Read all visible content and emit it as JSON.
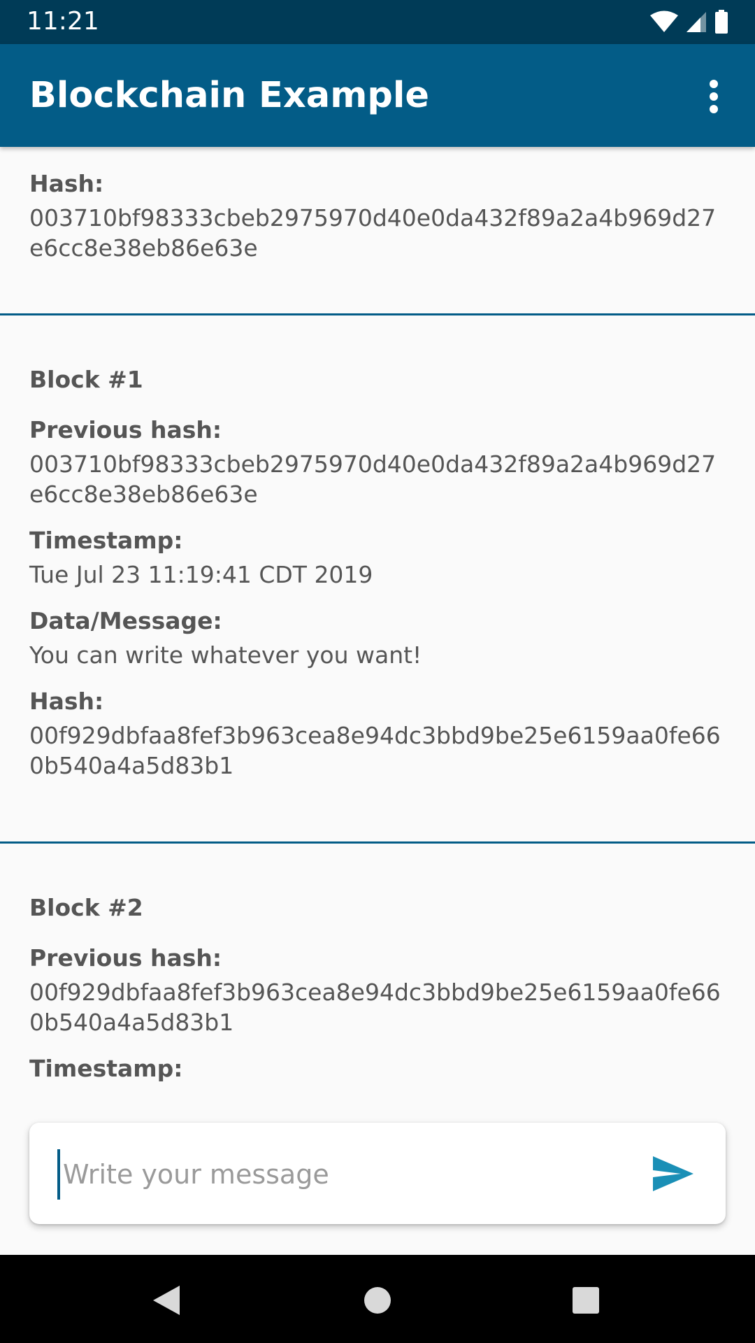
{
  "status_bar": {
    "time": "11:21"
  },
  "app_bar": {
    "title": "Blockchain Example"
  },
  "partial_block": {
    "hash_label": "Hash:",
    "hash": "003710bf98333cbeb2975970d40e0da432f89a2a4b969d27e6cc8e38eb86e63e"
  },
  "blocks": [
    {
      "title": "Block #1",
      "previous_hash_label": "Previous hash:",
      "previous_hash": "003710bf98333cbeb2975970d40e0da432f89a2a4b969d27e6cc8e38eb86e63e",
      "timestamp_label": "Timestamp:",
      "timestamp": "Tue Jul 23 11:19:41 CDT 2019",
      "message_label": "Data/Message:",
      "message": "You can write whatever you want!",
      "hash_label": "Hash:",
      "hash": "00f929dbfaa8fef3b963cea8e94dc3bbd9be25e6159aa0fe660b540a4a5d83b1"
    },
    {
      "title": "Block #2",
      "previous_hash_label": "Previous hash:",
      "previous_hash": "00f929dbfaa8fef3b963cea8e94dc3bbd9be25e6159aa0fe660b540a4a5d83b1",
      "timestamp_label": "Timestamp:"
    }
  ],
  "composer": {
    "placeholder": "Write your message"
  },
  "colors": {
    "primary": "#035c87",
    "status_bar": "#003b57",
    "accent": "#1a8fb6"
  }
}
